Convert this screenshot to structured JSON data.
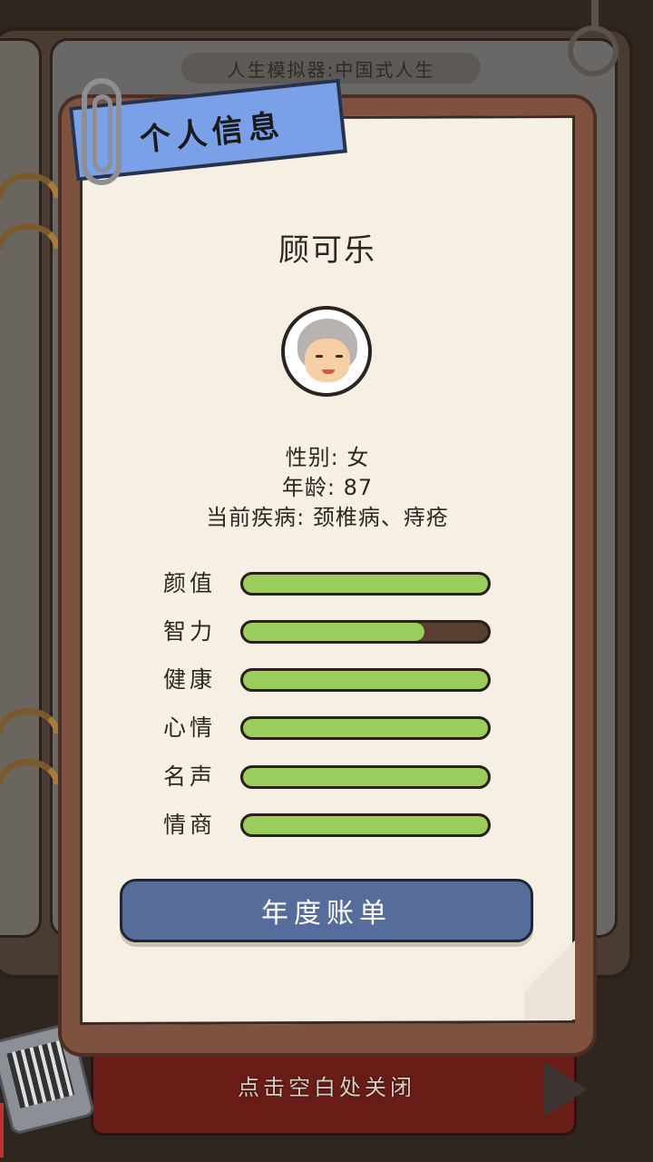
{
  "game": {
    "title": "人生模拟器:中国式人生"
  },
  "panel": {
    "header": "个人信息"
  },
  "character": {
    "name": "顾可乐",
    "gender_line": "性别: 女",
    "age_line": "年龄: 87",
    "disease_line": "当前疾病: 颈椎病、痔疮"
  },
  "stats": [
    {
      "label": "颜值",
      "level": 1.0
    },
    {
      "label": "智力",
      "level": 0.74
    },
    {
      "label": "健康",
      "level": 1.0
    },
    {
      "label": "心情",
      "level": 1.0
    },
    {
      "label": "名声",
      "level": 1.0
    },
    {
      "label": "情商",
      "level": 1.0
    }
  ],
  "actions": {
    "annual_bill": "年度账单"
  },
  "footer": {
    "close_hint": "点击空白处关闭"
  },
  "colors": {
    "stat_fill": "#9acd5c",
    "button": "#566c9a",
    "ribbon": "#7aa0e8"
  }
}
